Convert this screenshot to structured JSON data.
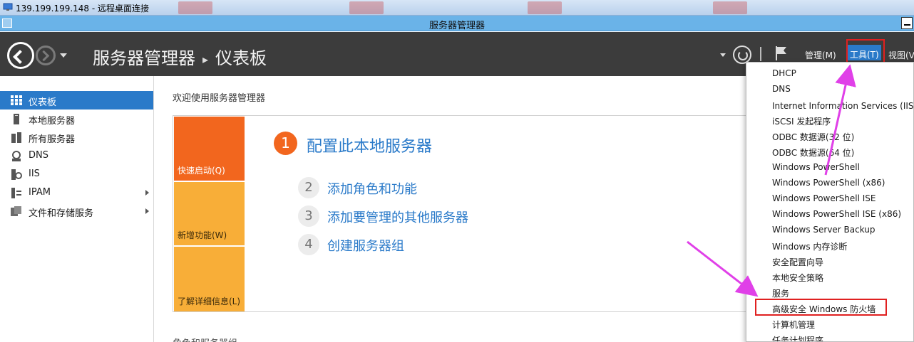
{
  "rdp": {
    "title": "139.199.199.148 - 远程桌面连接"
  },
  "window": {
    "title": "服务器管理器"
  },
  "header": {
    "breadcrumb_root": "服务器管理器",
    "breadcrumb_sep": "▸",
    "breadcrumb_page": "仪表板",
    "menus": {
      "manage": "管理(M)",
      "tools": "工具(T)",
      "view": "视图(V"
    }
  },
  "sidebar": {
    "items": [
      {
        "label": "仪表板",
        "icon": "dashboard-icon",
        "active": true
      },
      {
        "label": "本地服务器",
        "icon": "server-icon"
      },
      {
        "label": "所有服务器",
        "icon": "servers-icon"
      },
      {
        "label": "DNS",
        "icon": "dns-icon"
      },
      {
        "label": "IIS",
        "icon": "iis-icon"
      },
      {
        "label": "IPAM",
        "icon": "ipam-icon",
        "expandable": true
      },
      {
        "label": "文件和存储服务",
        "icon": "file-storage-icon",
        "expandable": true
      }
    ]
  },
  "main": {
    "welcome_title": "欢迎使用服务器管理器",
    "tiles": [
      "快速启动(Q)",
      "新增功能(W)",
      "了解详细信息(L)"
    ],
    "steps": [
      {
        "num": "1",
        "label": "配置此本地服务器"
      },
      {
        "num": "2",
        "label": "添加角色和功能"
      },
      {
        "num": "3",
        "label": "添加要管理的其他服务器"
      },
      {
        "num": "4",
        "label": "创建服务器组"
      }
    ],
    "next_section": "角色和服务器组"
  },
  "tools_menu": {
    "items": [
      "DHCP",
      "DNS",
      "Internet Information Services (IIS)管",
      "iSCSI 发起程序",
      "ODBC 数据源(32 位)",
      "ODBC 数据源(64 位)",
      "Windows PowerShell",
      "Windows PowerShell (x86)",
      "Windows PowerShell ISE",
      "Windows PowerShell ISE (x86)",
      "Windows Server Backup",
      "Windows 内存诊断",
      "安全配置向导",
      "本地安全策略",
      "服务",
      "高级安全 Windows 防火墙",
      "计算机管理",
      "任务计划程序"
    ],
    "highlighted": "高级安全 Windows 防火墙"
  },
  "colors": {
    "accent": "#2a7ac9",
    "quickstart": "#f2661e",
    "tile": "#f8ae38",
    "header": "#3c3c3c",
    "annotation": "#e02020",
    "arrow": "#e040e8"
  }
}
